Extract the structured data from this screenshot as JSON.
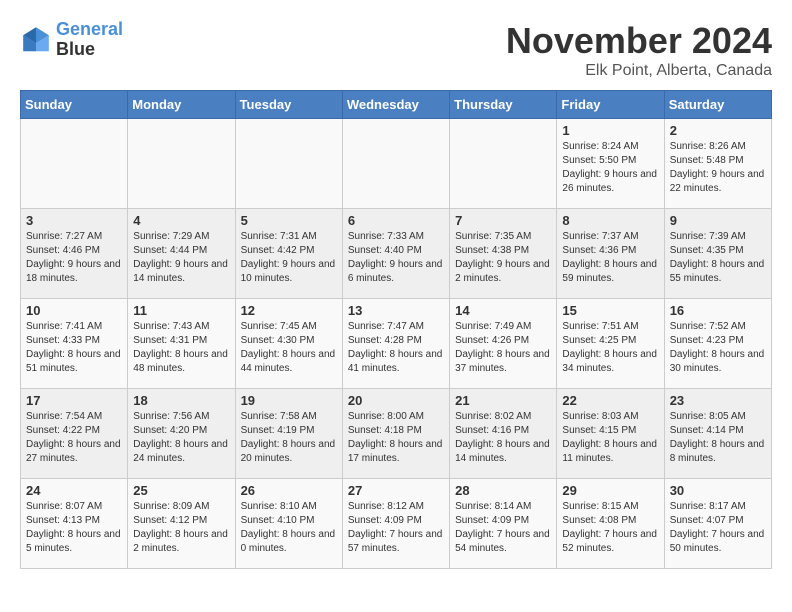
{
  "header": {
    "logo_line1": "General",
    "logo_line2": "Blue",
    "title": "November 2024",
    "subtitle": "Elk Point, Alberta, Canada"
  },
  "weekdays": [
    "Sunday",
    "Monday",
    "Tuesday",
    "Wednesday",
    "Thursday",
    "Friday",
    "Saturday"
  ],
  "weeks": [
    [
      {
        "day": "",
        "info": ""
      },
      {
        "day": "",
        "info": ""
      },
      {
        "day": "",
        "info": ""
      },
      {
        "day": "",
        "info": ""
      },
      {
        "day": "",
        "info": ""
      },
      {
        "day": "1",
        "info": "Sunrise: 8:24 AM\nSunset: 5:50 PM\nDaylight: 9 hours and 26 minutes."
      },
      {
        "day": "2",
        "info": "Sunrise: 8:26 AM\nSunset: 5:48 PM\nDaylight: 9 hours and 22 minutes."
      }
    ],
    [
      {
        "day": "3",
        "info": "Sunrise: 7:27 AM\nSunset: 4:46 PM\nDaylight: 9 hours and 18 minutes."
      },
      {
        "day": "4",
        "info": "Sunrise: 7:29 AM\nSunset: 4:44 PM\nDaylight: 9 hours and 14 minutes."
      },
      {
        "day": "5",
        "info": "Sunrise: 7:31 AM\nSunset: 4:42 PM\nDaylight: 9 hours and 10 minutes."
      },
      {
        "day": "6",
        "info": "Sunrise: 7:33 AM\nSunset: 4:40 PM\nDaylight: 9 hours and 6 minutes."
      },
      {
        "day": "7",
        "info": "Sunrise: 7:35 AM\nSunset: 4:38 PM\nDaylight: 9 hours and 2 minutes."
      },
      {
        "day": "8",
        "info": "Sunrise: 7:37 AM\nSunset: 4:36 PM\nDaylight: 8 hours and 59 minutes."
      },
      {
        "day": "9",
        "info": "Sunrise: 7:39 AM\nSunset: 4:35 PM\nDaylight: 8 hours and 55 minutes."
      }
    ],
    [
      {
        "day": "10",
        "info": "Sunrise: 7:41 AM\nSunset: 4:33 PM\nDaylight: 8 hours and 51 minutes."
      },
      {
        "day": "11",
        "info": "Sunrise: 7:43 AM\nSunset: 4:31 PM\nDaylight: 8 hours and 48 minutes."
      },
      {
        "day": "12",
        "info": "Sunrise: 7:45 AM\nSunset: 4:30 PM\nDaylight: 8 hours and 44 minutes."
      },
      {
        "day": "13",
        "info": "Sunrise: 7:47 AM\nSunset: 4:28 PM\nDaylight: 8 hours and 41 minutes."
      },
      {
        "day": "14",
        "info": "Sunrise: 7:49 AM\nSunset: 4:26 PM\nDaylight: 8 hours and 37 minutes."
      },
      {
        "day": "15",
        "info": "Sunrise: 7:51 AM\nSunset: 4:25 PM\nDaylight: 8 hours and 34 minutes."
      },
      {
        "day": "16",
        "info": "Sunrise: 7:52 AM\nSunset: 4:23 PM\nDaylight: 8 hours and 30 minutes."
      }
    ],
    [
      {
        "day": "17",
        "info": "Sunrise: 7:54 AM\nSunset: 4:22 PM\nDaylight: 8 hours and 27 minutes."
      },
      {
        "day": "18",
        "info": "Sunrise: 7:56 AM\nSunset: 4:20 PM\nDaylight: 8 hours and 24 minutes."
      },
      {
        "day": "19",
        "info": "Sunrise: 7:58 AM\nSunset: 4:19 PM\nDaylight: 8 hours and 20 minutes."
      },
      {
        "day": "20",
        "info": "Sunrise: 8:00 AM\nSunset: 4:18 PM\nDaylight: 8 hours and 17 minutes."
      },
      {
        "day": "21",
        "info": "Sunrise: 8:02 AM\nSunset: 4:16 PM\nDaylight: 8 hours and 14 minutes."
      },
      {
        "day": "22",
        "info": "Sunrise: 8:03 AM\nSunset: 4:15 PM\nDaylight: 8 hours and 11 minutes."
      },
      {
        "day": "23",
        "info": "Sunrise: 8:05 AM\nSunset: 4:14 PM\nDaylight: 8 hours and 8 minutes."
      }
    ],
    [
      {
        "day": "24",
        "info": "Sunrise: 8:07 AM\nSunset: 4:13 PM\nDaylight: 8 hours and 5 minutes."
      },
      {
        "day": "25",
        "info": "Sunrise: 8:09 AM\nSunset: 4:12 PM\nDaylight: 8 hours and 2 minutes."
      },
      {
        "day": "26",
        "info": "Sunrise: 8:10 AM\nSunset: 4:10 PM\nDaylight: 8 hours and 0 minutes."
      },
      {
        "day": "27",
        "info": "Sunrise: 8:12 AM\nSunset: 4:09 PM\nDaylight: 7 hours and 57 minutes."
      },
      {
        "day": "28",
        "info": "Sunrise: 8:14 AM\nSunset: 4:09 PM\nDaylight: 7 hours and 54 minutes."
      },
      {
        "day": "29",
        "info": "Sunrise: 8:15 AM\nSunset: 4:08 PM\nDaylight: 7 hours and 52 minutes."
      },
      {
        "day": "30",
        "info": "Sunrise: 8:17 AM\nSunset: 4:07 PM\nDaylight: 7 hours and 50 minutes."
      }
    ]
  ]
}
